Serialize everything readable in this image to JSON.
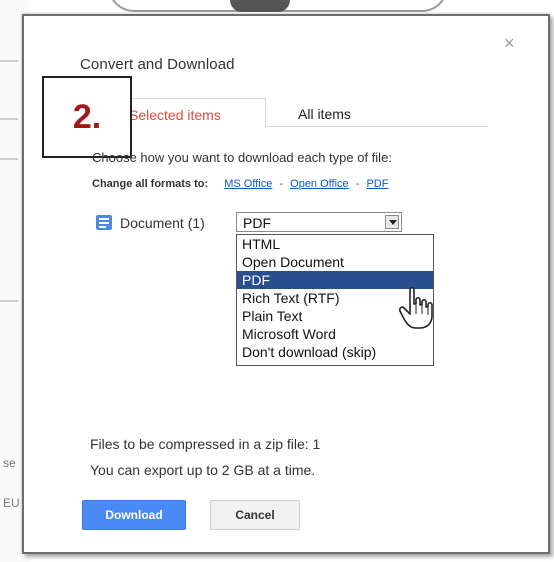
{
  "background": {
    "fragment_1": "se",
    "fragment_2": "EU"
  },
  "dialog": {
    "title": "Convert and Download",
    "close_glyph": "×",
    "tabs": [
      {
        "label": "Selected items",
        "visible_label": "ele:ted items",
        "active": true
      },
      {
        "label": "All items",
        "active": false
      }
    ],
    "step_annotation": "2.",
    "instruction": "Choose how you want to download each type of file:",
    "change_formats": {
      "label": "Change all formats to:",
      "links": [
        "MS Office",
        "Open Office",
        "PDF"
      ],
      "separator": "-"
    },
    "document_row": {
      "icon": "document-icon",
      "label": "Document (1)",
      "select_value": "PDF",
      "options": [
        "HTML",
        "Open Document",
        "PDF",
        "Rich Text (RTF)",
        "Plain Text",
        "Microsoft Word",
        "Don't download (skip)"
      ],
      "highlighted_option": "PDF"
    },
    "files_compressed": "Files to be compressed in a zip file: 1",
    "export_limit": "You can export up to 2 GB at a time.",
    "buttons": {
      "download": "Download",
      "cancel": "Cancel"
    },
    "colors": {
      "active_tab": "#dd4b39",
      "link": "#1155cc",
      "primary_button": "#4a8af4",
      "highlight": "#2a4f8e",
      "annotation": "#a01a1a"
    }
  }
}
